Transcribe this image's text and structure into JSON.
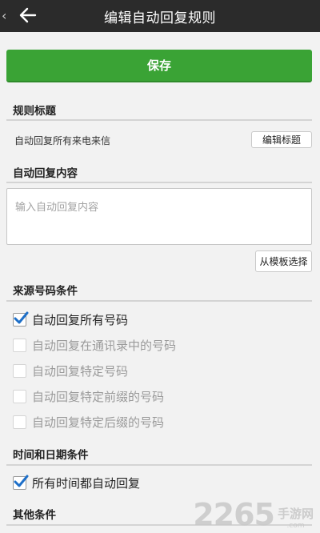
{
  "header": {
    "title": "编辑自动回复规则"
  },
  "actions": {
    "save_label": "保存"
  },
  "sections": {
    "rule_title": {
      "heading": "规则标题",
      "value": "自动回复所有来电来信",
      "edit_label": "编辑标题"
    },
    "reply_content": {
      "heading": "自动回复内容",
      "placeholder": "输入自动回复内容",
      "template_label": "从模板选择"
    },
    "source_conditions": {
      "heading": "来源号码条件",
      "options": [
        {
          "label": "自动回复所有号码",
          "checked": true,
          "enabled": true
        },
        {
          "label": "自动回复在通讯录中的号码",
          "checked": false,
          "enabled": false
        },
        {
          "label": "自动回复特定号码",
          "checked": false,
          "enabled": false
        },
        {
          "label": "自动回复特定前缀的号码",
          "checked": false,
          "enabled": false
        },
        {
          "label": "自动回复特定后缀的号码",
          "checked": false,
          "enabled": false
        }
      ]
    },
    "time_conditions": {
      "heading": "时间和日期条件",
      "options": [
        {
          "label": "所有时间都自动回复",
          "checked": true,
          "enabled": true
        }
      ]
    },
    "other_conditions": {
      "heading": "其他条件"
    }
  },
  "watermark": {
    "number": "2265",
    "cn": "手游网",
    "domain": ".com"
  },
  "colors": {
    "accent_green": "#3aa335",
    "topbar": "#2b2b2b",
    "check_blue": "#1e6fc8"
  },
  "icons": {
    "back": "arrow-left-icon",
    "chevron": "chevron-left-icon",
    "check": "checkmark-icon"
  }
}
